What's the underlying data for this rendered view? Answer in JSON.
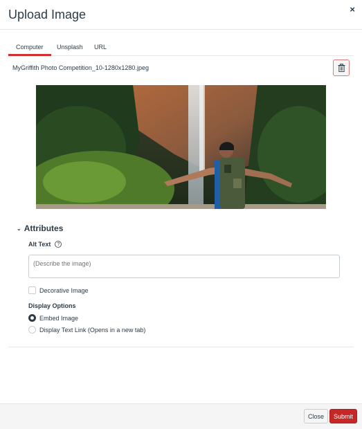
{
  "modal": {
    "title": "Upload Image",
    "close_icon": "×"
  },
  "tabs": [
    {
      "label": "Computer",
      "active": true
    },
    {
      "label": "Unsplash",
      "active": false
    },
    {
      "label": "URL",
      "active": false
    }
  ],
  "file": {
    "name": "MyGriffith Photo Competition_10-1280x1280.jpeg",
    "delete_icon": "trash-icon",
    "preview_alt": "Person with backpack, arms outstretched, facing a waterfall surrounded by green rainforest and orange cliffs"
  },
  "attributes": {
    "heading": "Attributes",
    "alt_text_label": "Alt Text",
    "alt_text_help": "?",
    "alt_text_value": "",
    "alt_text_placeholder": "(Describe the image)",
    "decorative_label": "Decorative Image",
    "decorative_checked": false,
    "display_options_label": "Display Options",
    "display_options": [
      {
        "label": "Embed Image",
        "checked": true
      },
      {
        "label": "Display Text Link (Opens in a new tab)",
        "checked": false
      }
    ]
  },
  "footer": {
    "close_label": "Close",
    "submit_label": "Submit"
  },
  "colors": {
    "accent": "#c62828",
    "text": "#2d3b45"
  }
}
